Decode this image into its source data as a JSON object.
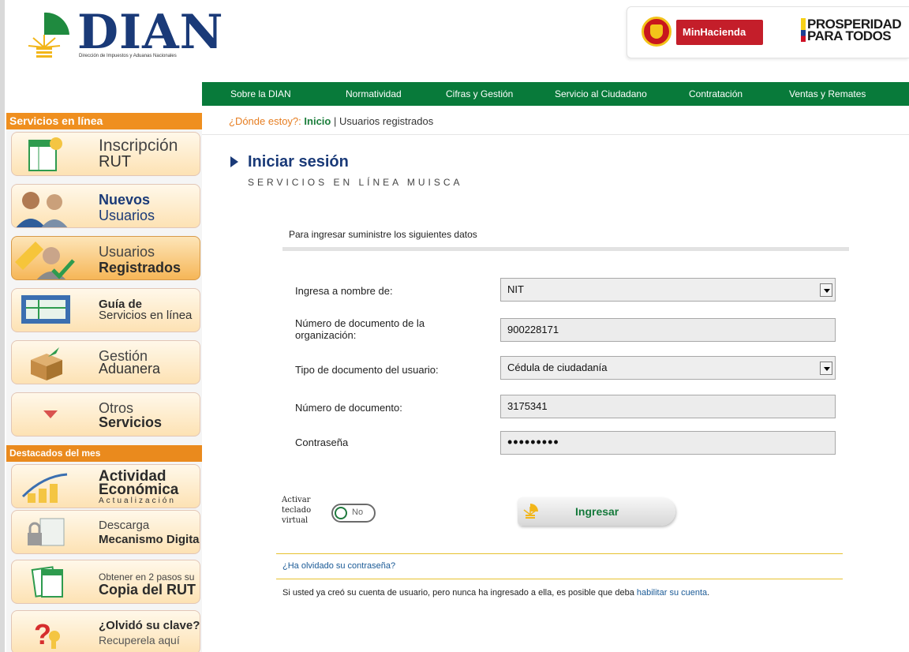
{
  "brand": {
    "logo_text": "DIAN",
    "logo_subtitle": "Dirección de Impuestos y Aduanas Nacionales",
    "gov_logo_text": "MinHacienda",
    "prosperidad_line1": "PROSPERIDAD",
    "prosperidad_line2": "PARA TODOS"
  },
  "topnav": {
    "items": [
      "Sobre la DIAN",
      "Normatividad",
      "Cifras y Gestión",
      "Servicio al Ciudadano",
      "Contratación",
      "Ventas y Remates"
    ]
  },
  "sidebar": {
    "header_services": "Servicios en línea",
    "header_featured": "Destacados del mes",
    "items": [
      {
        "line1": "Inscripción",
        "line2": "RUT"
      },
      {
        "line1": "Nuevos",
        "line2": "Usuarios"
      },
      {
        "line1": "Usuarios",
        "line2": "Registrados"
      },
      {
        "line1": "Guía de",
        "line2": "Servicios en línea"
      },
      {
        "line1": "Gestión",
        "line2": "Aduanera"
      },
      {
        "line1": "Otros",
        "line2": "Servicios"
      }
    ],
    "featured": [
      {
        "line1": "Actividad",
        "line2": "Económica",
        "line3": "Actualización"
      },
      {
        "line1": "Descarga",
        "line2": "Mecanismo Digital"
      },
      {
        "line1": "Obtener en 2 pasos su",
        "line2": "Copia del RUT"
      },
      {
        "line1": "¿Olvidó su clave?",
        "line2": "Recuperela aquí"
      }
    ]
  },
  "breadcrumb": {
    "prefix": "¿Dónde estoy?:",
    "home": "Inicio",
    "separator": "|",
    "current": "Usuarios registrados"
  },
  "main": {
    "title": "Iniciar sesión",
    "subtitle": "SERVICIOS EN LÍNEA MUISCA",
    "intro": "Para ingresar suministre los siguientes datos",
    "form": {
      "ingresa_label": "Ingresa a nombre de:",
      "ingresa_value": "NIT",
      "org_doc_label": "Número de documento de la organización:",
      "org_doc_value": "900228171",
      "tipo_doc_label": "Tipo de documento del usuario:",
      "tipo_doc_value": "Cédula de ciudadanía",
      "num_doc_label": "Número de documento:",
      "num_doc_value": "3175341",
      "password_label": "Contraseña",
      "password_value": "•••••••••"
    },
    "keyboard_label_1": "Activar",
    "keyboard_label_2": "teclado",
    "keyboard_label_3": "virtual",
    "keyboard_toggle_value": "No",
    "submit_label": "Ingresar",
    "forgot_link": "¿Ha olvidado su contraseña?",
    "note_text": "Si usted ya creó su cuenta de usuario, pero nunca ha ingresado a ella, es posible que deba ",
    "note_link": "habilitar su cuenta",
    "note_end": "."
  },
  "colors": {
    "nav_green": "#087a3a",
    "sidebar_orange": "#ef8f1f",
    "title_blue": "#1a3a78"
  }
}
